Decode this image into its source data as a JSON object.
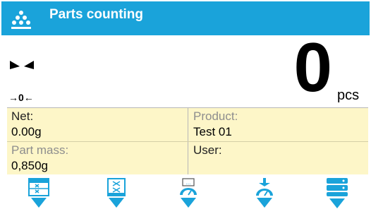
{
  "header": {
    "title": "Parts counting",
    "icon": "parts-counting-icon",
    "background": "#1aa3da"
  },
  "display": {
    "value": "0",
    "unit": "pcs",
    "zero_indicator": "→0←",
    "stable_icon": "stability-marker-icon"
  },
  "info": {
    "background": "#fdf6c8",
    "net": {
      "label": "Net:",
      "value": "0.00g"
    },
    "product": {
      "label": "Product:",
      "value": "Test 01"
    },
    "part_mass": {
      "label": "Part mass:",
      "value": "0,850g"
    },
    "user": {
      "label": "User:",
      "value": ""
    }
  },
  "toolbar": {
    "accent": "#1aa3da",
    "buttons": [
      {
        "name": "sample-quantity-button",
        "icon": "sample-grid-icon"
      },
      {
        "name": "part-mass-entry-button",
        "icon": "part-mass-icon"
      },
      {
        "name": "weigh-sample-button",
        "icon": "weighing-scale-icon"
      },
      {
        "name": "tare-button",
        "icon": "tare-scale-icon"
      },
      {
        "name": "database-button",
        "icon": "database-icon"
      }
    ]
  }
}
